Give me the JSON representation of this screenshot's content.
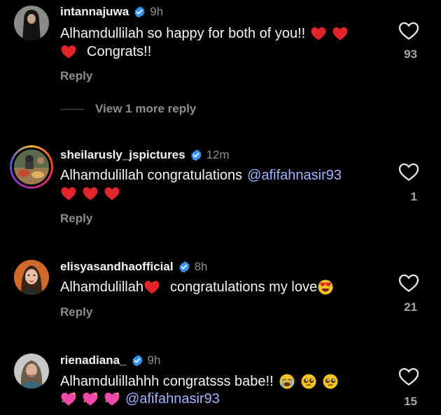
{
  "colors": {
    "background": "#000000",
    "text": "#f5f5f5",
    "muted": "#8e8e8e",
    "verified": "#3897f0",
    "mention": "#a3b3ff"
  },
  "comments": [
    {
      "username": "intannajuwa",
      "verified": true,
      "time": "9h",
      "text_line1": "Alhamdullilah so happy for both of you!!",
      "line1_emojis": [
        "red-heart",
        "red-heart"
      ],
      "line2_emojis": [
        "red-heart"
      ],
      "text_line2": "Congrats!!",
      "reply_label": "Reply",
      "likes": "93",
      "view_more_label": "View 1 more reply",
      "avatar_icon": "woman-in-black-hijab-avatar"
    },
    {
      "username": "sheilarusly_jspictures",
      "verified": true,
      "time": "12m",
      "text_line1": "Alhamdulillah congratulations",
      "mention1": "@afifahnasir93",
      "line2_emojis": [
        "red-heart",
        "red-heart",
        "red-heart"
      ],
      "reply_label": "Reply",
      "likes": "1",
      "avatar_icon": "food-table-avatar",
      "has_story_ring": true
    },
    {
      "username": "elisyasandhaofficial",
      "verified": true,
      "time": "8h",
      "text_part1": "Alhamdulillah",
      "text_part2": "congratulations my love",
      "emojis": [
        "red-heart",
        "heart-eyes-face"
      ],
      "reply_label": "Reply",
      "likes": "21",
      "avatar_icon": "woman-portrait-avatar"
    },
    {
      "username": "rienadiana_",
      "verified": true,
      "time": "9h",
      "text_line1": "Alhamdulillahhh congratsss babe!!",
      "line1_emojis": [
        "loudly-crying-face",
        "pleading-face",
        "pleading-face"
      ],
      "line2_emojis": [
        "sparkling-heart",
        "sparkling-heart",
        "sparkling-heart"
      ],
      "mention2": "@afifahnasir93",
      "likes": "15",
      "avatar_icon": "woman-in-hijab-avatar"
    }
  ]
}
